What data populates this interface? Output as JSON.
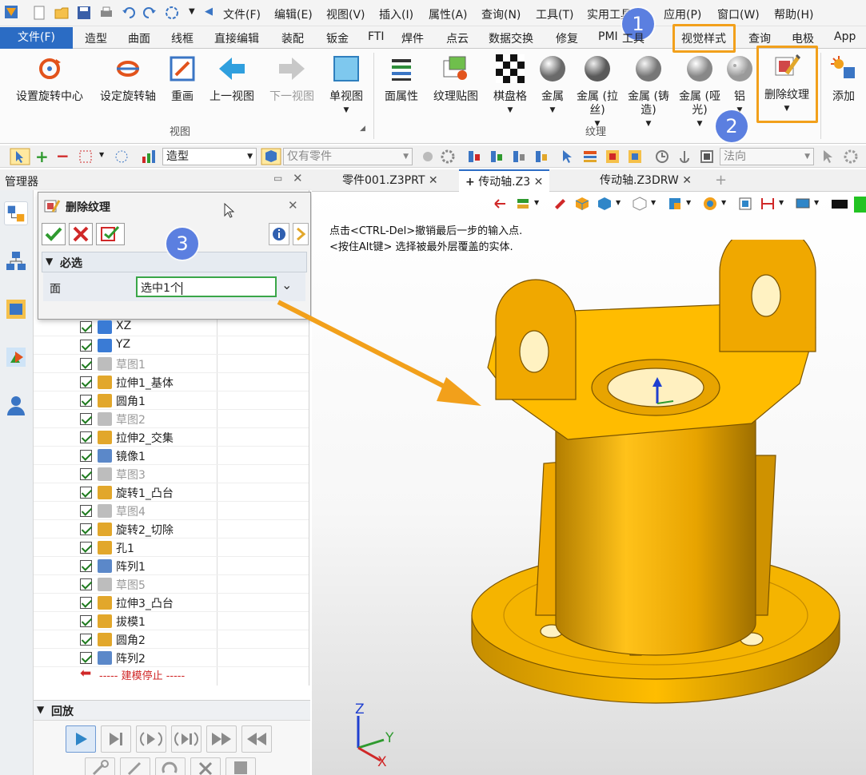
{
  "titlebar": {
    "menus": [
      "文件(F)",
      "编辑(E)",
      "视图(V)",
      "插入(I)",
      "属性(A)",
      "查询(N)",
      "工具(T)",
      "实用工具",
      "应用(P)",
      "窗口(W)",
      "帮助(H)"
    ]
  },
  "ribbon_tabs": {
    "file": "文件(F)",
    "items": [
      "造型",
      "曲面",
      "线框",
      "直接编辑",
      "装配",
      "钣金",
      "FTI",
      "焊件",
      "点云",
      "数据交换",
      "修复",
      "PMI",
      "工具",
      "视觉样式",
      "查询",
      "电极",
      "App"
    ],
    "active": "视觉样式"
  },
  "ribbon": {
    "view_group": {
      "label": "视图",
      "buttons": [
        "设置旋转中心",
        "设定旋转轴",
        "重画",
        "上一视图",
        "下一视图",
        "单视图"
      ]
    },
    "texture_group": {
      "label": "纹理",
      "buttons": [
        "面属性",
        "纹理贴图",
        "棋盘格",
        "金属",
        "金属 (拉丝)",
        "金属 (铸造)",
        "金属 (哑光)",
        "铝",
        "删除纹理"
      ]
    },
    "add_label": "添加"
  },
  "toolbar": {
    "mode_combo": "造型",
    "filter_combo": "仅有零件",
    "normal_combo": "法向"
  },
  "manager": {
    "title": "管理器"
  },
  "dialog": {
    "title": "删除纹理",
    "section": "必选",
    "field_label": "面",
    "field_value": "选中1个"
  },
  "tree": {
    "items": [
      {
        "label": "XZ",
        "dim": false,
        "color": "#3a7bd5"
      },
      {
        "label": "YZ",
        "dim": false,
        "color": "#3a7bd5"
      },
      {
        "label": "草图1",
        "dim": true,
        "color": "#bdbdbd"
      },
      {
        "label": "拉伸1_基体",
        "dim": false,
        "color": "#e2a72b"
      },
      {
        "label": "圆角1",
        "dim": false,
        "color": "#e2a72b"
      },
      {
        "label": "草图2",
        "dim": true,
        "color": "#bdbdbd"
      },
      {
        "label": "拉伸2_交集",
        "dim": false,
        "color": "#e2a72b"
      },
      {
        "label": "镜像1",
        "dim": false,
        "color": "#5b88c9"
      },
      {
        "label": "草图3",
        "dim": true,
        "color": "#bdbdbd"
      },
      {
        "label": "旋转1_凸台",
        "dim": false,
        "color": "#e2a72b"
      },
      {
        "label": "草图4",
        "dim": true,
        "color": "#bdbdbd"
      },
      {
        "label": "旋转2_切除",
        "dim": false,
        "color": "#e2a72b"
      },
      {
        "label": "孔1",
        "dim": false,
        "color": "#e2a72b"
      },
      {
        "label": "阵列1",
        "dim": false,
        "color": "#5b88c9"
      },
      {
        "label": "草图5",
        "dim": true,
        "color": "#bdbdbd"
      },
      {
        "label": "拉伸3_凸台",
        "dim": false,
        "color": "#e2a72b"
      },
      {
        "label": "拔模1",
        "dim": false,
        "color": "#e2a72b"
      },
      {
        "label": "圆角2",
        "dim": false,
        "color": "#e2a72b"
      },
      {
        "label": "阵列2",
        "dim": false,
        "color": "#5b88c9"
      }
    ],
    "stop_label": "----- 建模停止 -----"
  },
  "playback": {
    "title": "回放"
  },
  "doc_tabs": [
    {
      "label": "零件001.Z3PRT",
      "active": false
    },
    {
      "label": "传动轴.Z3",
      "active": true
    },
    {
      "label": "传动轴.Z3DRW",
      "active": false
    }
  ],
  "viewport": {
    "hint1": "点击<CTRL-Del>撤销最后一步的输入点.",
    "hint2": "<按住Alt键> 选择被最外层覆盖的实体.",
    "axis_z": "Z",
    "axis_y": "Y",
    "axis_x": "X"
  },
  "annotations": [
    "1",
    "2",
    "3"
  ],
  "colors": {
    "accent": "#2b6cc4",
    "highlight": "#f2a01b",
    "badge": "#5b7fe0",
    "part": "#e8a400"
  }
}
